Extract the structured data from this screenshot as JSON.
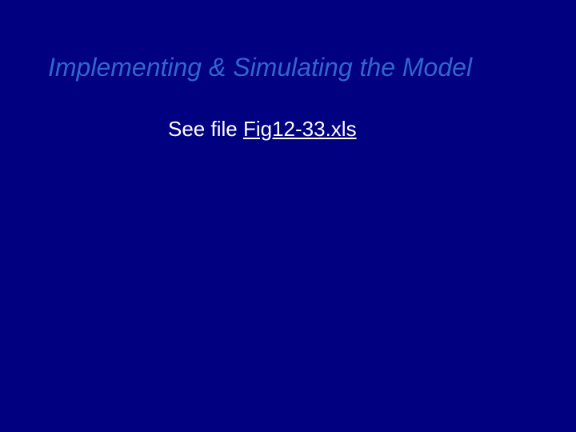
{
  "slide": {
    "title": "Implementing & Simulating the Model",
    "body_prefix": "See file ",
    "file_link": "Fig12-33.xls"
  }
}
